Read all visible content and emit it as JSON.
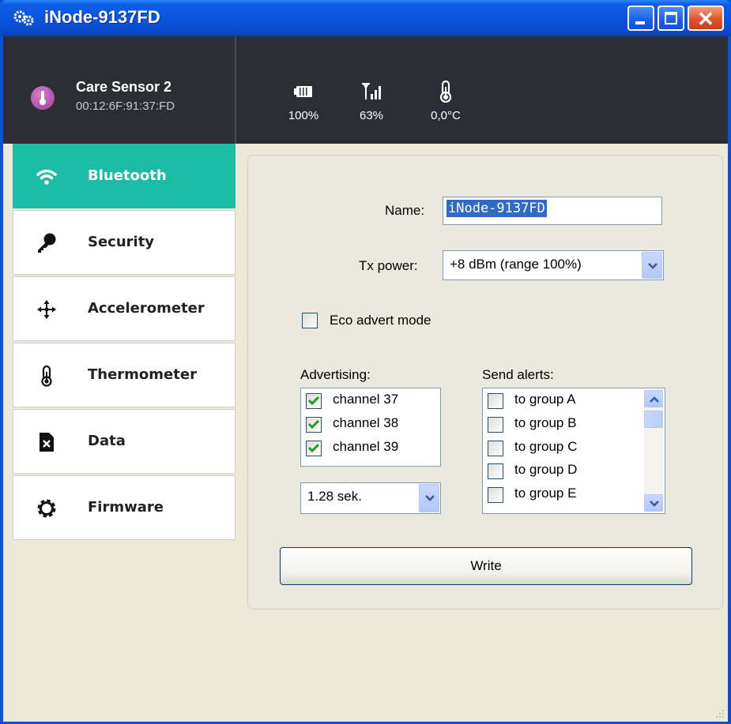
{
  "window": {
    "title": "iNode-9137FD",
    "close_glyph": "✕"
  },
  "device": {
    "name": "Care Sensor 2",
    "mac": "00:12:6F:91:37:FD",
    "icon": "thermometer-avatar-icon"
  },
  "stats": [
    {
      "icon": "battery-icon",
      "value": "100%"
    },
    {
      "icon": "signal-icon",
      "value": "63%"
    },
    {
      "icon": "thermometer-icon",
      "value": "0,0°C"
    }
  ],
  "sidebar": {
    "items": [
      {
        "label": "Bluetooth",
        "icon": "wifi-icon",
        "active": true
      },
      {
        "label": "Security",
        "icon": "key-icon",
        "active": false
      },
      {
        "label": "Accelerometer",
        "icon": "move-arrows-icon",
        "active": false
      },
      {
        "label": "Thermometer",
        "icon": "thermometer-icon",
        "active": false
      },
      {
        "label": "Data",
        "icon": "file-x-icon",
        "active": false
      },
      {
        "label": "Firmware",
        "icon": "gear-icon",
        "active": false
      }
    ]
  },
  "form": {
    "name_label": "Name:",
    "name_value": "iNode-9137FD",
    "tx_label": "Tx power:",
    "tx_value": "+8 dBm  (range 100%)",
    "eco_label": "Eco advert mode",
    "eco_checked": false,
    "advertising_label": "Advertising:",
    "advertising_channels": [
      {
        "label": "channel 37",
        "checked": true
      },
      {
        "label": "channel 38",
        "checked": true
      },
      {
        "label": "channel 39",
        "checked": true
      }
    ],
    "interval_value": "1.28 sek.",
    "alerts_label": "Send alerts:",
    "alert_groups": [
      {
        "label": "to group A",
        "checked": false
      },
      {
        "label": "to group B",
        "checked": false
      },
      {
        "label": "to group C",
        "checked": false
      },
      {
        "label": "to group D",
        "checked": false
      },
      {
        "label": "to group E",
        "checked": false
      }
    ],
    "write_label": "Write"
  },
  "colors": {
    "title_bar": "#0a54dc",
    "header_bg": "#2b2e33",
    "active_nav": "#1cbca4",
    "selection": "#316ac5"
  }
}
